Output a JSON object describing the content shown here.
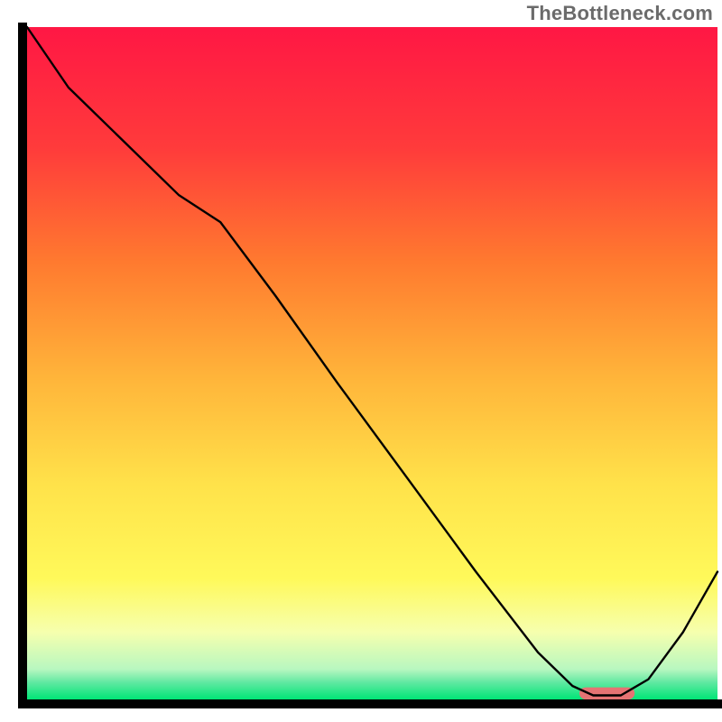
{
  "watermark": "TheBottleneck.com",
  "chart_data": {
    "type": "line",
    "title": "",
    "xlabel": "",
    "ylabel": "",
    "xlim": [
      0,
      100
    ],
    "ylim": [
      0,
      100
    ],
    "legend": false,
    "grid": false,
    "background_gradient": {
      "stops": [
        {
          "offset": 0.0,
          "color": "#ff1744"
        },
        {
          "offset": 0.18,
          "color": "#ff3b3b"
        },
        {
          "offset": 0.35,
          "color": "#ff7a2f"
        },
        {
          "offset": 0.52,
          "color": "#ffb43a"
        },
        {
          "offset": 0.68,
          "color": "#ffe24a"
        },
        {
          "offset": 0.82,
          "color": "#fff95a"
        },
        {
          "offset": 0.9,
          "color": "#f6ffae"
        },
        {
          "offset": 0.955,
          "color": "#b8f7c0"
        },
        {
          "offset": 0.975,
          "color": "#5fe8a1"
        },
        {
          "offset": 1.0,
          "color": "#00e676"
        }
      ]
    },
    "series": [
      {
        "name": "curve",
        "stroke": "#000000",
        "stroke_width": 2.4,
        "x": [
          0,
          6,
          14,
          22,
          28,
          36,
          45,
          55,
          65,
          74,
          79,
          82,
          86,
          90,
          95,
          100
        ],
        "y": [
          100,
          91,
          83,
          75,
          71,
          60,
          47,
          33,
          19,
          7,
          2,
          0.6,
          0.6,
          3,
          10,
          19
        ]
      }
    ],
    "marker": {
      "name": "optimal-range-marker",
      "x_start": 80,
      "x_end": 88,
      "y": 0.9,
      "height": 1.8,
      "color": "#e57373"
    }
  }
}
